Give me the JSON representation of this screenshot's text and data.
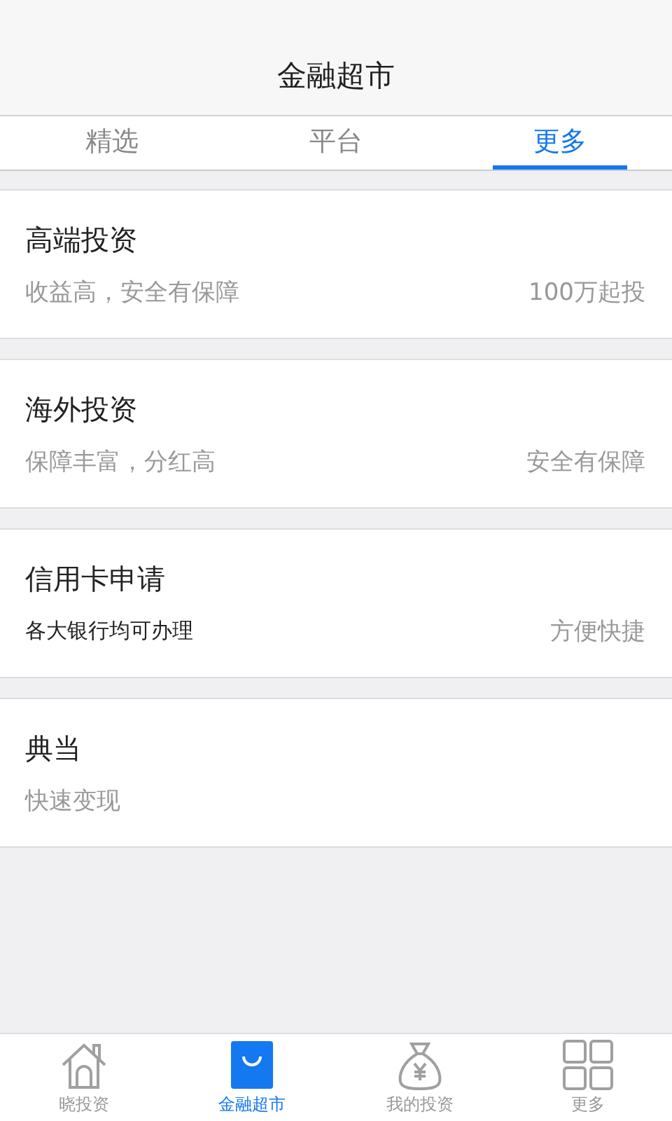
{
  "header": {
    "title": "金融超市"
  },
  "tabs": [
    {
      "label": "精选",
      "selected": false
    },
    {
      "label": "平台",
      "selected": false
    },
    {
      "label": "更多",
      "selected": true
    }
  ],
  "cards": [
    {
      "title": "高端投资",
      "subtitle": {
        "text": "收益高，安全有保障",
        "kind": "muted"
      },
      "note": "100万起投"
    },
    {
      "title": "海外投资",
      "subtitle": {
        "text": "保障丰富，分红高",
        "kind": "muted"
      },
      "note": "安全有保障"
    },
    {
      "title": "信用卡申请",
      "subtitle": {
        "text": "各大银行均可办理",
        "kind": "dark"
      },
      "note": "方便快捷"
    },
    {
      "title": "典当",
      "subtitle": {
        "text": "快速变现",
        "kind": "muted"
      }
    }
  ],
  "bottom_nav": [
    {
      "label": "晓投资",
      "selected": false
    },
    {
      "label": "金融超市",
      "selected": true
    },
    {
      "label": "我的投资",
      "selected": false
    },
    {
      "label": "更多",
      "selected": false
    }
  ]
}
